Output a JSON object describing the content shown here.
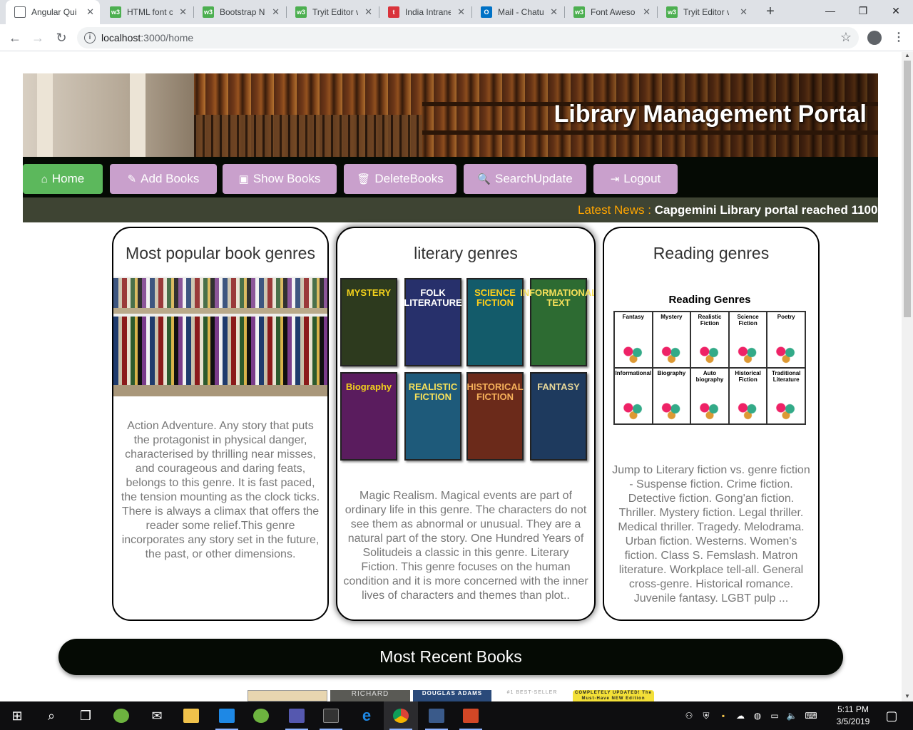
{
  "browser": {
    "tabs": [
      {
        "title": "Angular Qui",
        "icon": "document-icon",
        "active": true
      },
      {
        "title": "HTML font c",
        "icon": "w3schools-icon"
      },
      {
        "title": "Bootstrap N",
        "icon": "w3schools-icon"
      },
      {
        "title": "Tryit Editor v",
        "icon": "w3schools-icon"
      },
      {
        "title": "India Intrane",
        "icon": "t-icon"
      },
      {
        "title": "Mail - Chatu",
        "icon": "outlook-icon"
      },
      {
        "title": "Font Aweso",
        "icon": "w3schools-icon"
      },
      {
        "title": "Tryit Editor v",
        "icon": "w3schools-icon"
      }
    ],
    "url_host": "localhost",
    "url_rest": ":3000/home"
  },
  "page": {
    "title": "Library Management Portal",
    "nav": [
      {
        "label": "Home",
        "icon": "home-icon",
        "active": true
      },
      {
        "label": "Add Books",
        "icon": "edit-icon"
      },
      {
        "label": "Show Books",
        "icon": "image-icon"
      },
      {
        "label": "DeleteBooks",
        "icon": "trash-icon"
      },
      {
        "label": "SearchUpdate",
        "icon": "search-icon"
      },
      {
        "label": "Logout",
        "icon": "sign-out-icon"
      }
    ],
    "news_label": "Latest News :",
    "news_text": "Capgemini Library portal reached 1100",
    "cards": [
      {
        "title": "Most popular book genres",
        "text": "Action Adventure. Any story that puts the protagonist in physical danger, characterised by thrilling near misses, and courageous and daring feats, belongs to this genre. It is fast paced, the tension mounting as the clock ticks. There is always a climax that offers the reader some relief.This genre incorporates any story set in the future, the past, or other dimensions."
      },
      {
        "title": "literary genres",
        "text": "Magic Realism. Magical events are part of ordinary life in this genre. The characters do not see them as abnormal or unusual. They are a natural part of the story. One Hundred Years of Solitudeis a classic in this genre. Literary Fiction. This genre focuses on the human condition and it is more concerned with the inner lives of characters and themes than plot..",
        "posters": [
          "MYSTERY",
          "FOLK LITERATURE",
          "SCIENCE FICTION",
          "INFORMATIONAL TEXT",
          "Biography",
          "REALISTIC FICTION",
          "HISTORICAL FICTION",
          "FANTASY"
        ]
      },
      {
        "title": "Reading genres",
        "text": "Jump to Literary fiction vs. genre fiction - Suspense fiction. Crime fiction. Detective fiction. Gong'an fiction. Thriller. Mystery fiction. Legal thriller. Medical thriller. Tragedy. Melodrama. Urban fiction. Westerns. Women's fiction. Class S. Femslash. Matron literature. Workplace tell-all. General cross-genre. Historical romance. Juvenile fantasy. LGBT pulp ...",
        "chart_title": "Reading Genres",
        "chart_cells": [
          "Fantasy",
          "Mystery",
          "Realistic Fiction",
          "Science Fiction",
          "Poetry",
          "Informational",
          "Biography",
          "Auto biography",
          "Historical Fiction",
          "Traditional Literature"
        ]
      }
    ],
    "recent_title": "Most Recent Books",
    "covers": [
      "",
      "RICHARD",
      "DOUGLAS ADAMS",
      "#1 BEST-SELLER",
      "COMPLETELY UPDATED! The Must-Have NEW Edition"
    ]
  },
  "taskbar": {
    "time": "5:11 PM",
    "date": "3/5/2019"
  }
}
